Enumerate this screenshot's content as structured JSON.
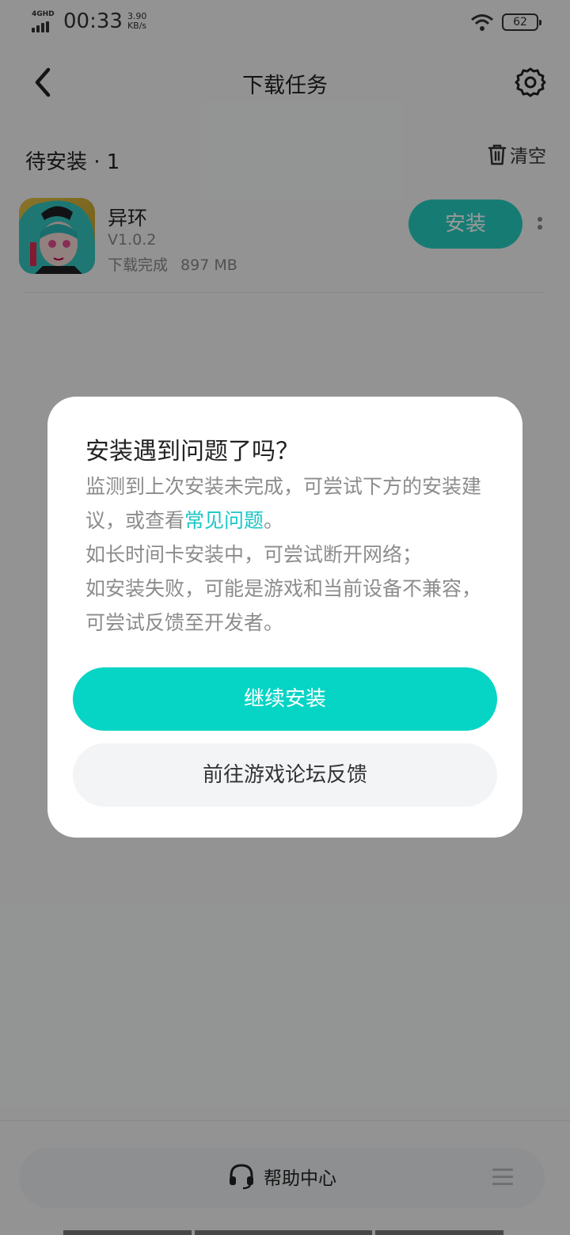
{
  "status_bar": {
    "network": "4GHD",
    "time": "00:33",
    "speed_value": "3.90",
    "speed_unit": "KB/s",
    "battery": "62"
  },
  "header": {
    "title": "下载任务",
    "back_icon": "chevron-left-icon",
    "settings_icon": "gear-icon"
  },
  "section": {
    "title": "待安装 · 1",
    "clear_label": "清空",
    "clear_icon": "trash-icon"
  },
  "task": {
    "name": "异环",
    "version": "V1.0.2",
    "status": "下载完成",
    "size": "897 MB",
    "install_label": "安装",
    "more_icon": "more-vertical-icon"
  },
  "dialog": {
    "title": "安装遇到问题了吗？",
    "body_part1": "监测到上次安装未完成，可尝试下方的安装建议，或查看",
    "link": "常见问题",
    "body_part2": "。",
    "body_line3": "如长时间卡安装中，可尝试断开网络；",
    "body_line4": "如安装失败，可能是游戏和当前设备不兼容，可尝试反馈至开发者。",
    "continue_label": "继续安装",
    "forum_label": "前往游戏论坛反馈"
  },
  "bottom": {
    "help_label": "帮助中心",
    "help_icon": "headset-icon",
    "menu_icon": "menu-icon"
  },
  "colors": {
    "accent": "#06d5c5",
    "install_button": "#26cfc0",
    "link": "#1bc6c6"
  }
}
